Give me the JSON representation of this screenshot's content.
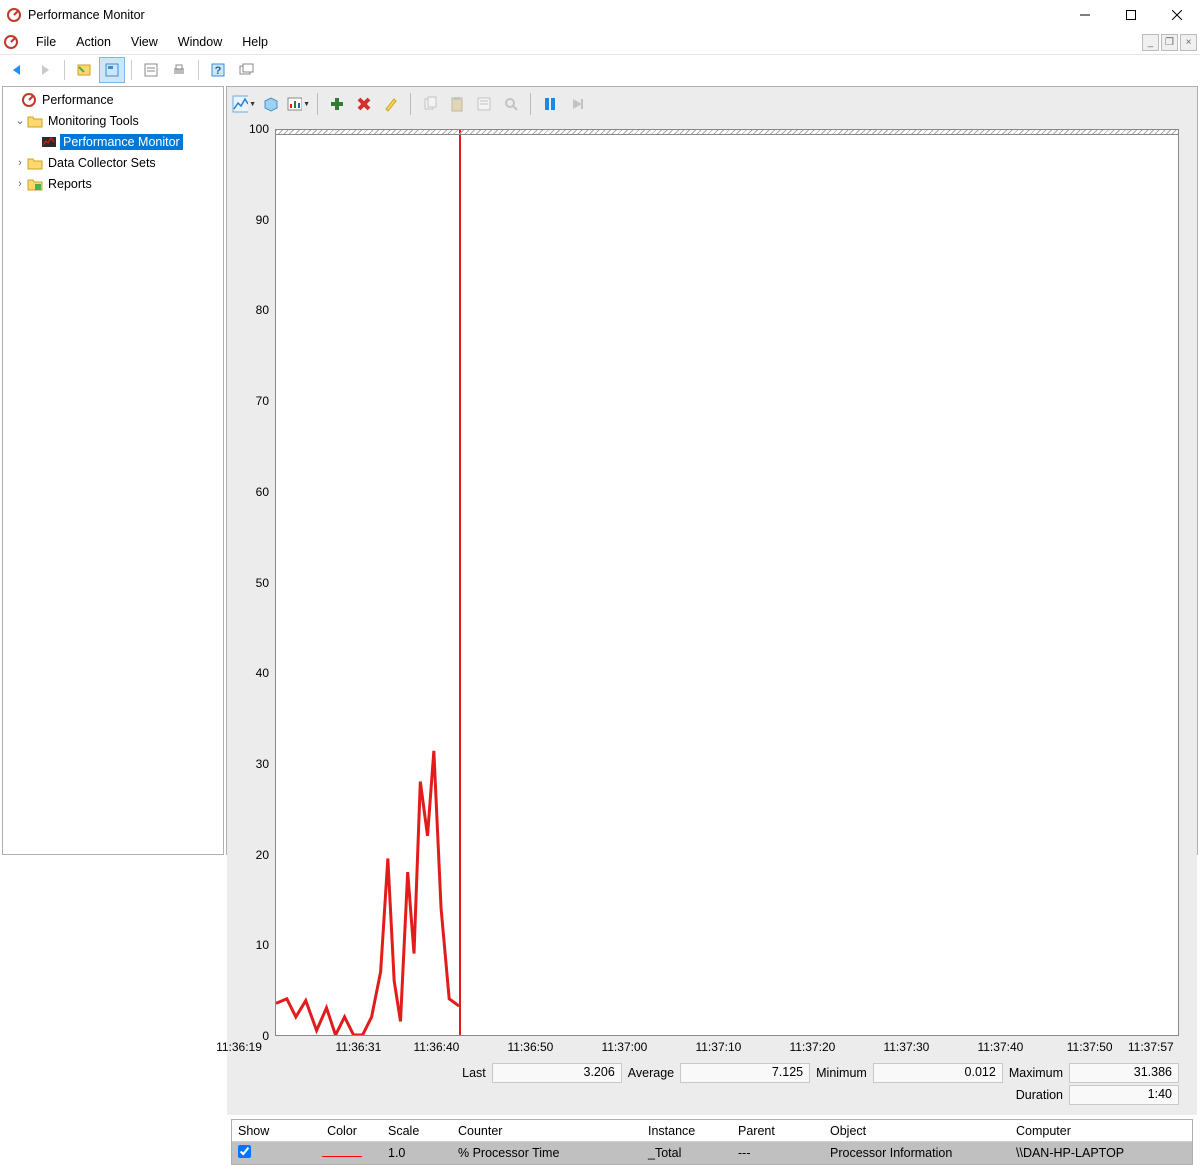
{
  "window": {
    "title": "Performance Monitor"
  },
  "menu": {
    "file": "File",
    "action": "Action",
    "view": "View",
    "window": "Window",
    "help": "Help"
  },
  "tree": {
    "root": "Performance",
    "monitoring": "Monitoring Tools",
    "perfmon": "Performance Monitor",
    "dcs": "Data Collector Sets",
    "reports": "Reports"
  },
  "stats": {
    "last_label": "Last",
    "last": "3.206",
    "avg_label": "Average",
    "avg": "7.125",
    "min_label": "Minimum",
    "min": "0.012",
    "max_label": "Maximum",
    "max": "31.386",
    "dur_label": "Duration",
    "dur": "1:40"
  },
  "legend": {
    "h_show": "Show",
    "h_color": "Color",
    "h_scale": "Scale",
    "h_counter": "Counter",
    "h_inst": "Instance",
    "h_parent": "Parent",
    "h_obj": "Object",
    "h_comp": "Computer",
    "r_scale": "1.0",
    "r_counter": "% Processor Time",
    "r_inst": "_Total",
    "r_parent": "---",
    "r_obj": "Processor Information",
    "r_comp": "\\\\DAN-HP-LAPTOP"
  },
  "chart_data": {
    "type": "line",
    "title": "",
    "ylabel": "",
    "ylim": [
      0,
      100
    ],
    "y_ticks": [
      0,
      10,
      20,
      30,
      40,
      50,
      60,
      70,
      80,
      90,
      100
    ],
    "x_ticks": [
      "11:36:19",
      "11:36:31",
      "11:36:40",
      "11:36:50",
      "11:37:00",
      "11:37:10",
      "11:37:20",
      "11:37:30",
      "11:37:40",
      "11:37:50",
      "11:37:57"
    ],
    "x_tick_rel": [
      0,
      0.127,
      0.21,
      0.31,
      0.41,
      0.51,
      0.61,
      0.71,
      0.81,
      0.905,
      0.97
    ],
    "series": [
      {
        "name": "% Processor Time",
        "color": "#e21b1b",
        "points": [
          {
            "t": 0.0,
            "v": 3.5
          },
          {
            "t": 0.012,
            "v": 4.0
          },
          {
            "t": 0.022,
            "v": 2.0
          },
          {
            "t": 0.033,
            "v": 3.8
          },
          {
            "t": 0.045,
            "v": 0.5
          },
          {
            "t": 0.056,
            "v": 3.0
          },
          {
            "t": 0.066,
            "v": 0.0
          },
          {
            "t": 0.076,
            "v": 2.0
          },
          {
            "t": 0.086,
            "v": 0.0
          },
          {
            "t": 0.096,
            "v": 0.0
          },
          {
            "t": 0.106,
            "v": 2.0
          },
          {
            "t": 0.116,
            "v": 7.0
          },
          {
            "t": 0.124,
            "v": 19.5
          },
          {
            "t": 0.131,
            "v": 6.0
          },
          {
            "t": 0.138,
            "v": 1.5
          },
          {
            "t": 0.146,
            "v": 18.0
          },
          {
            "t": 0.153,
            "v": 9.0
          },
          {
            "t": 0.16,
            "v": 28.0
          },
          {
            "t": 0.168,
            "v": 22.0
          },
          {
            "t": 0.175,
            "v": 31.4
          },
          {
            "t": 0.183,
            "v": 14.0
          },
          {
            "t": 0.192,
            "v": 4.0
          },
          {
            "t": 0.203,
            "v": 3.2
          }
        ],
        "cursor_t": 0.204
      }
    ]
  }
}
